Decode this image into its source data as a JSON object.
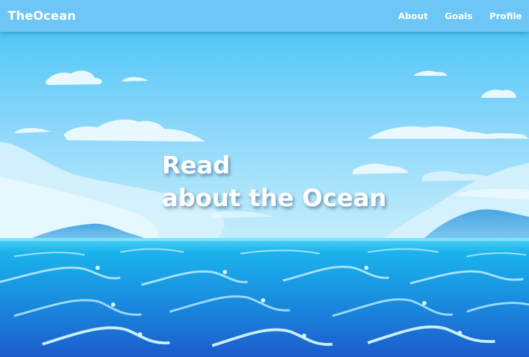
{
  "nav": {
    "brand": "TheOcean",
    "links": [
      {
        "label": "About"
      },
      {
        "label": "Goals"
      },
      {
        "label": "Profile"
      }
    ]
  },
  "hero": {
    "headline_line1": "Read",
    "headline_line2": "about the Ocean",
    "background_image": "ocean-seascape-illustration"
  },
  "colors": {
    "navbar": "#6ec6f7",
    "sky_top": "#48c4f6",
    "sky_bottom": "#b5e8fb",
    "sea_top": "#20b2ee",
    "sea_bottom": "#1c63cf"
  }
}
